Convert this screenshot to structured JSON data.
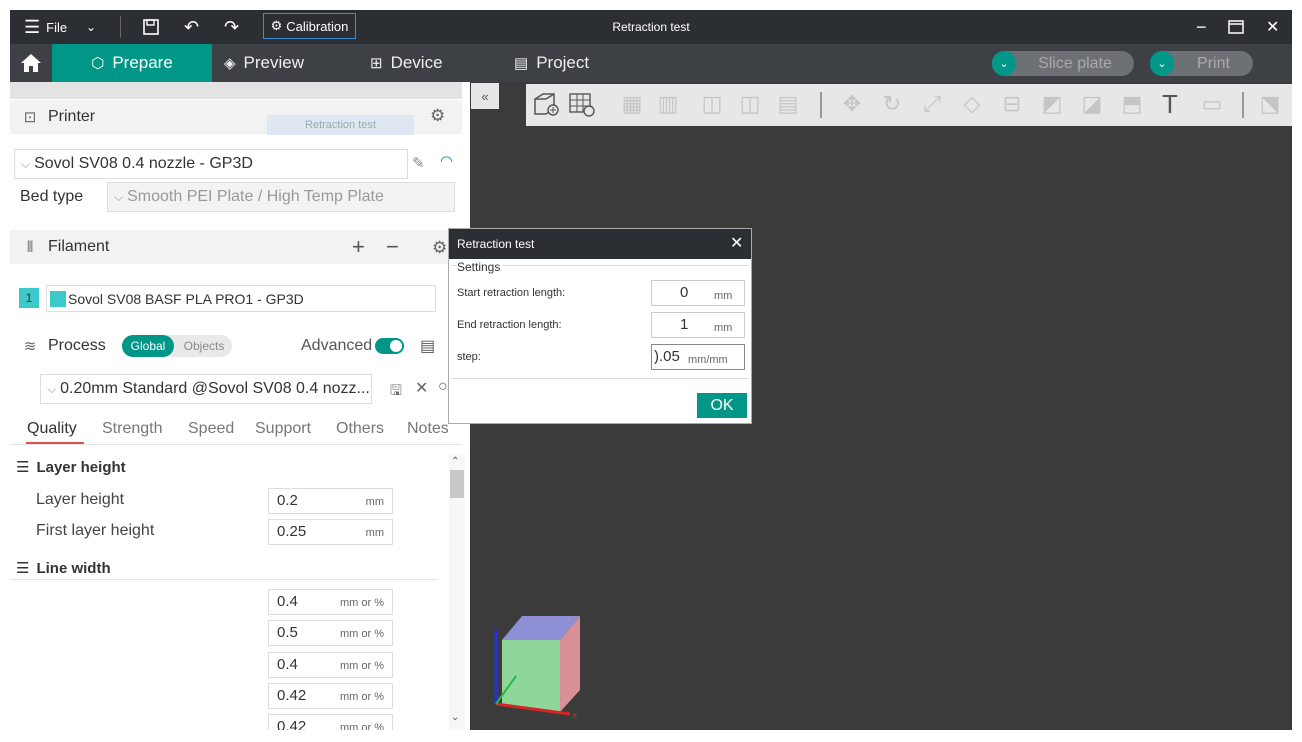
{
  "titlebar": {
    "file_label": "File",
    "calibration_label": "Calibration",
    "window_title": "Retraction test"
  },
  "nav": {
    "prepare": "Prepare",
    "preview": "Preview",
    "device": "Device",
    "project": "Project",
    "slice_plate": "Slice plate",
    "print": "Print"
  },
  "printer": {
    "heading": "Printer",
    "tooltip": "Retraction test",
    "selected": "Sovol SV08 0.4 nozzle - GP3D",
    "bed_type_label": "Bed type",
    "bed_type_value": "Smooth PEI Plate / High Temp Plate"
  },
  "filament": {
    "heading": "Filament",
    "slot_number": "1",
    "selected": "Sovol SV08 BASF PLA PRO1 - GP3D",
    "color": "#3cc9c9"
  },
  "process": {
    "heading": "Process",
    "global_label": "Global",
    "objects_label": "Objects",
    "advanced_label": "Advanced",
    "advanced_on": true,
    "preset": "0.20mm Standard @Sovol SV08 0.4 nozz..."
  },
  "quality_tabs": [
    "Quality",
    "Strength",
    "Speed",
    "Support",
    "Others",
    "Notes"
  ],
  "layer_height_section": {
    "heading": "Layer height",
    "rows": [
      {
        "label": "Layer height",
        "value": "0.2",
        "unit": "mm"
      },
      {
        "label": "First layer height",
        "value": "0.25",
        "unit": "mm"
      }
    ]
  },
  "line_width_section": {
    "heading": "Line width",
    "rows": [
      {
        "label": "",
        "value": "0.4",
        "unit": "mm or %"
      },
      {
        "label": "",
        "value": "0.5",
        "unit": "mm or %"
      },
      {
        "label": "",
        "value": "0.4",
        "unit": "mm or %"
      },
      {
        "label": "",
        "value": "0.42",
        "unit": "mm or %"
      },
      {
        "label": "",
        "value": "0.42",
        "unit": "mm or %"
      }
    ]
  },
  "dialog": {
    "title": "Retraction test",
    "group_label": "Settings",
    "start_label": "Start retraction length:",
    "start_value": "0",
    "start_unit": "mm",
    "end_label": "End retraction length:",
    "end_value": "1",
    "end_unit": "mm",
    "step_label": "step:",
    "step_value": ").05",
    "step_unit": "mm/mm",
    "ok_label": "OK"
  },
  "colors": {
    "accent": "#009688",
    "titlebar": "#2b2f33",
    "canvas": "#3b3b3b"
  }
}
